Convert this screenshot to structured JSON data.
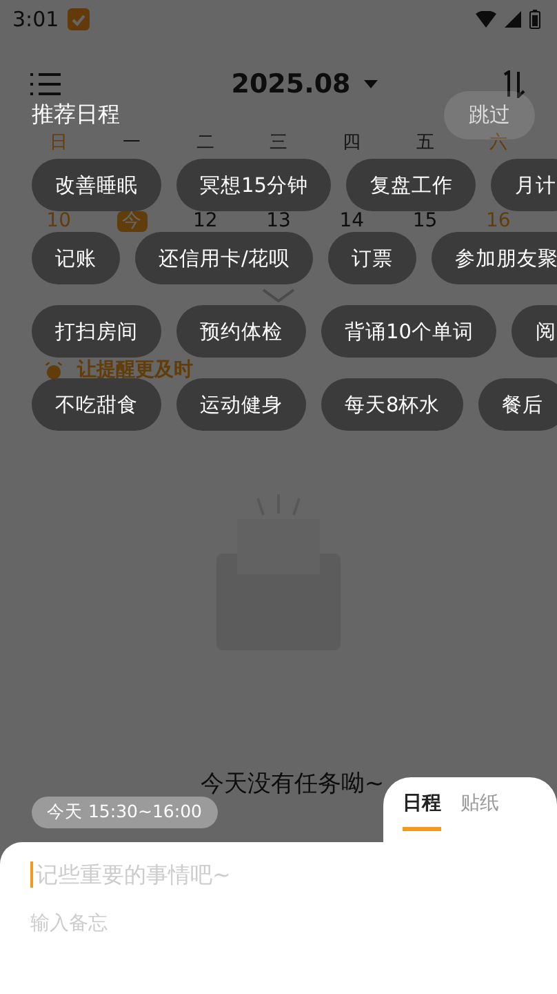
{
  "status_bar": {
    "time": "3:01"
  },
  "header": {
    "month": "2025.08"
  },
  "calendar": {
    "weekdays": [
      {
        "label": "日",
        "weekend": true
      },
      {
        "label": "一",
        "weekend": false
      },
      {
        "label": "二",
        "weekend": false
      },
      {
        "label": "三",
        "weekend": false
      },
      {
        "label": "四",
        "weekend": false
      },
      {
        "label": "五",
        "weekend": false
      },
      {
        "label": "六",
        "weekend": true
      }
    ],
    "dates": [
      {
        "label": "10",
        "weekend": true,
        "selected": false
      },
      {
        "label": "今",
        "weekend": false,
        "selected": true
      },
      {
        "label": "12",
        "weekend": false,
        "selected": false
      },
      {
        "label": "13",
        "weekend": false,
        "selected": false
      },
      {
        "label": "14",
        "weekend": false,
        "selected": false
      },
      {
        "label": "15",
        "weekend": false,
        "selected": false
      },
      {
        "label": "16",
        "weekend": true,
        "selected": false
      }
    ]
  },
  "banner": {
    "title": "让提醒更及时"
  },
  "empty_state": {
    "message": "今天没有任务呦~"
  },
  "recommend": {
    "title": "推荐日程",
    "skip": "跳过",
    "chip_rows": [
      [
        "改善睡眠",
        "冥想15分钟",
        "复盘工作",
        "月计"
      ],
      [
        "记账",
        "还信用卡/花呗",
        "订票",
        "参加朋友聚"
      ],
      [
        "打扫房间",
        "预约体检",
        "背诵10个单词",
        "阅"
      ],
      [
        "不吃甜食",
        "运动健身",
        "每天8杯水",
        "餐后"
      ]
    ]
  },
  "editor": {
    "time_chip": "今天 15:30~16:00",
    "tabs": [
      {
        "label": "日程",
        "selected": true
      },
      {
        "label": "贴纸",
        "selected": false
      }
    ],
    "title_placeholder": "记些重要的事情吧~",
    "memo_placeholder": "输入备忘"
  }
}
